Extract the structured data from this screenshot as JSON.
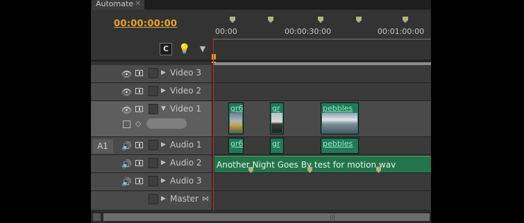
{
  "panel": {
    "tab_label": "Automate",
    "close_glyph": "✕",
    "timecode": "00:00:00:00"
  },
  "tools": {
    "snap_glyph": "C",
    "bulb_glyph": "💡",
    "marker_glyph": "▼"
  },
  "ruler": {
    "labels": [
      "00:00",
      "00:00:30:00",
      "00:01:00:00"
    ]
  },
  "tracks": [
    {
      "name": "Video 3",
      "type": "video"
    },
    {
      "name": "Video 2",
      "type": "video"
    },
    {
      "name": "Video 1",
      "type": "video",
      "expanded": true
    },
    {
      "name": "Audio 1",
      "type": "audio",
      "source_patch": "A1"
    },
    {
      "name": "Audio 2",
      "type": "audio"
    },
    {
      "name": "Audio 3",
      "type": "audio"
    },
    {
      "name": "Master",
      "type": "master"
    }
  ],
  "video_clips": [
    {
      "label": "gr6"
    },
    {
      "label": "gr"
    },
    {
      "label": "pebbles"
    }
  ],
  "audio1_clips": [
    {
      "label": "gr6"
    },
    {
      "label": "gr"
    },
    {
      "label": "pebbles"
    }
  ],
  "audio2_clip": {
    "label": "Another Night Goes By test for motion.wav"
  },
  "glyphs": {
    "eye": "👁",
    "speaker": "🔊",
    "tri_right": "▶",
    "tri_down": "▼",
    "master_icon": "⋈"
  },
  "colors": {
    "timecode": "#e6a42c",
    "clip_green": "#1f7a5c",
    "playhead": "#c8281e"
  }
}
